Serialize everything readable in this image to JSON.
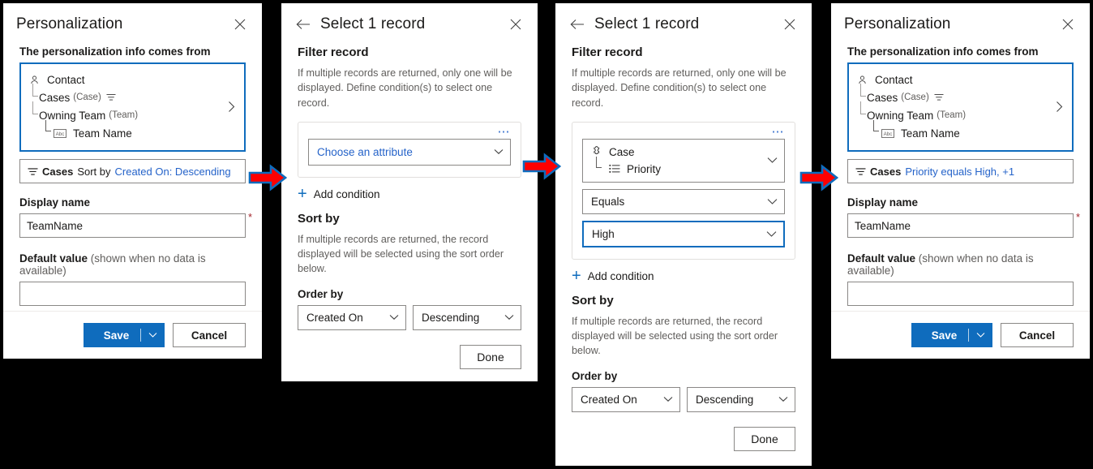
{
  "panel1": {
    "title": "Personalization",
    "close_icon": "close-icon",
    "source_label": "The personalization info comes from",
    "tree": [
      {
        "icon": "person-icon",
        "label": "Contact",
        "entity": "",
        "indent": 0
      },
      {
        "icon": "filter-icon",
        "label": "Cases",
        "entity": "(Case)",
        "indent": 1
      },
      {
        "icon": "",
        "label": "Owning Team",
        "entity": "(Team)",
        "indent": 1
      },
      {
        "icon": "abc-icon",
        "label": "Team Name",
        "entity": "",
        "indent": 2
      }
    ],
    "expand_icon": "chevron-right-icon",
    "filter_pill": {
      "icon": "filter-icon",
      "entity": "Cases",
      "text": "Sort by",
      "link": "Created On: Descending"
    },
    "display_name_label": "Display name",
    "display_name_value": "TeamName",
    "required_marker": "*",
    "default_value_label": "Default value",
    "default_value_hint": "(shown when no data is available)",
    "default_value_value": "",
    "save_label": "Save",
    "save_split_icon": "chevron-down-icon",
    "cancel_label": "Cancel"
  },
  "panel2": {
    "back_icon": "back-arrow-icon",
    "title": "Select 1 record",
    "close_icon": "close-icon",
    "filter_section_title": "Filter record",
    "filter_section_desc": "If multiple records are returned, only one will be displayed. Define condition(s) to select one record.",
    "card_overflow_icon": "ellipsis-icon",
    "attribute_placeholder": "Choose an attribute",
    "attribute_chevron": "chevron-down-icon",
    "add_condition_label": "Add condition",
    "sort_section_title": "Sort by",
    "sort_section_desc": "If multiple records are returned, the record displayed will be selected using the sort order below.",
    "order_by_label": "Order by",
    "order_by_field": "Created On",
    "order_by_direction": "Descending",
    "done_label": "Done"
  },
  "panel3": {
    "back_icon": "back-arrow-icon",
    "title": "Select 1 record",
    "close_icon": "close-icon",
    "filter_section_title": "Filter record",
    "filter_section_desc": "If multiple records are returned, only one will be displayed. Define condition(s) to select one record.",
    "card_overflow_icon": "ellipsis-icon",
    "attribute_entity_icon": "case-icon",
    "attribute_entity": "Case",
    "attribute_field_icon": "optionset-icon",
    "attribute_field": "Priority",
    "operator_value": "Equals",
    "condition_value": "High",
    "add_condition_label": "Add condition",
    "sort_section_title": "Sort by",
    "sort_section_desc": "If multiple records are returned, the record displayed will be selected using the sort order below.",
    "order_by_label": "Order by",
    "order_by_field": "Created On",
    "order_by_direction": "Descending",
    "done_label": "Done"
  },
  "panel4": {
    "title": "Personalization",
    "close_icon": "close-icon",
    "source_label": "The personalization info comes from",
    "tree": [
      {
        "icon": "person-icon",
        "label": "Contact",
        "entity": "",
        "indent": 0
      },
      {
        "icon": "filter-icon",
        "label": "Cases",
        "entity": "(Case)",
        "indent": 1
      },
      {
        "icon": "",
        "label": "Owning Team",
        "entity": "(Team)",
        "indent": 1
      },
      {
        "icon": "abc-icon",
        "label": "Team Name",
        "entity": "",
        "indent": 2
      }
    ],
    "expand_icon": "chevron-right-icon",
    "filter_pill": {
      "icon": "filter-icon",
      "entity": "Cases",
      "text": "",
      "link": "Priority equals High, +1"
    },
    "display_name_label": "Display name",
    "display_name_value": "TeamName",
    "required_marker": "*",
    "default_value_label": "Default value",
    "default_value_hint": "(shown when no data is available)",
    "default_value_value": "",
    "save_label": "Save",
    "save_split_icon": "chevron-down-icon",
    "cancel_label": "Cancel"
  },
  "arrows": [
    {
      "name": "flow-arrow-1"
    },
    {
      "name": "flow-arrow-2"
    },
    {
      "name": "flow-arrow-3"
    }
  ],
  "colors": {
    "accent": "#0f6cbd",
    "link": "#2563c9",
    "arrow_fill": "#ff0000",
    "arrow_stroke": "#0f6cbd",
    "required": "#a4262c",
    "background": "#000000"
  }
}
